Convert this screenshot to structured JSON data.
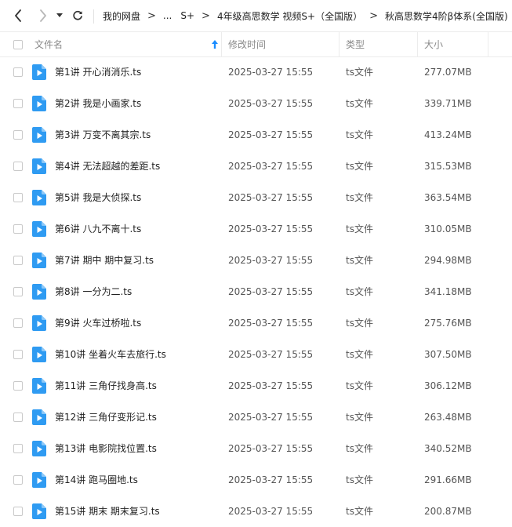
{
  "toolbar": {
    "back_icon": "chevron-left-icon",
    "forward_icon": "chevron-right-icon",
    "dropdown_icon": "caret-down-icon",
    "refresh_icon": "refresh-icon"
  },
  "breadcrumb": [
    {
      "label": "我的网盘"
    },
    {
      "label": "..."
    },
    {
      "label": "S+"
    },
    {
      "label": "4年级高思数学 视频S+（全国版）"
    },
    {
      "label": "秋高思数学4阶β体系(全国版)"
    }
  ],
  "columns": {
    "name": "文件名",
    "modified": "修改时间",
    "type": "类型",
    "size": "大小",
    "sort_icon": "sort-arrow-up-icon"
  },
  "colors": {
    "accent": "#1a8cff",
    "file_icon": "#2f9bf2"
  },
  "files": [
    {
      "name": "第1讲 开心消消乐.ts",
      "modified": "2025-03-27 15:55",
      "type": "ts文件",
      "size": "277.07MB"
    },
    {
      "name": "第2讲 我是小画家.ts",
      "modified": "2025-03-27 15:55",
      "type": "ts文件",
      "size": "339.71MB"
    },
    {
      "name": "第3讲 万变不离其宗.ts",
      "modified": "2025-03-27 15:55",
      "type": "ts文件",
      "size": "413.24MB"
    },
    {
      "name": "第4讲 无法超越的差距.ts",
      "modified": "2025-03-27 15:55",
      "type": "ts文件",
      "size": "315.53MB"
    },
    {
      "name": "第5讲 我是大侦探.ts",
      "modified": "2025-03-27 15:55",
      "type": "ts文件",
      "size": "363.54MB"
    },
    {
      "name": "第6讲 八九不离十.ts",
      "modified": "2025-03-27 15:55",
      "type": "ts文件",
      "size": "310.05MB"
    },
    {
      "name": "第7讲 期中  期中复习.ts",
      "modified": "2025-03-27 15:55",
      "type": "ts文件",
      "size": "294.98MB"
    },
    {
      "name": "第8讲 一分为二.ts",
      "modified": "2025-03-27 15:55",
      "type": "ts文件",
      "size": "341.18MB"
    },
    {
      "name": "第9讲 火车过桥啦.ts",
      "modified": "2025-03-27 15:55",
      "type": "ts文件",
      "size": "275.76MB"
    },
    {
      "name": "第10讲 坐着火车去旅行.ts",
      "modified": "2025-03-27 15:55",
      "type": "ts文件",
      "size": "307.50MB"
    },
    {
      "name": "第11讲 三角仔找身高.ts",
      "modified": "2025-03-27 15:55",
      "type": "ts文件",
      "size": "306.12MB"
    },
    {
      "name": "第12讲 三角仔变形记.ts",
      "modified": "2025-03-27 15:55",
      "type": "ts文件",
      "size": "263.48MB"
    },
    {
      "name": "第13讲 电影院找位置.ts",
      "modified": "2025-03-27 15:55",
      "type": "ts文件",
      "size": "340.52MB"
    },
    {
      "name": "第14讲 跑马圈地.ts",
      "modified": "2025-03-27 15:55",
      "type": "ts文件",
      "size": "291.66MB"
    },
    {
      "name": "第15讲 期末  期末复习.ts",
      "modified": "2025-03-27 15:55",
      "type": "ts文件",
      "size": "200.87MB"
    }
  ]
}
